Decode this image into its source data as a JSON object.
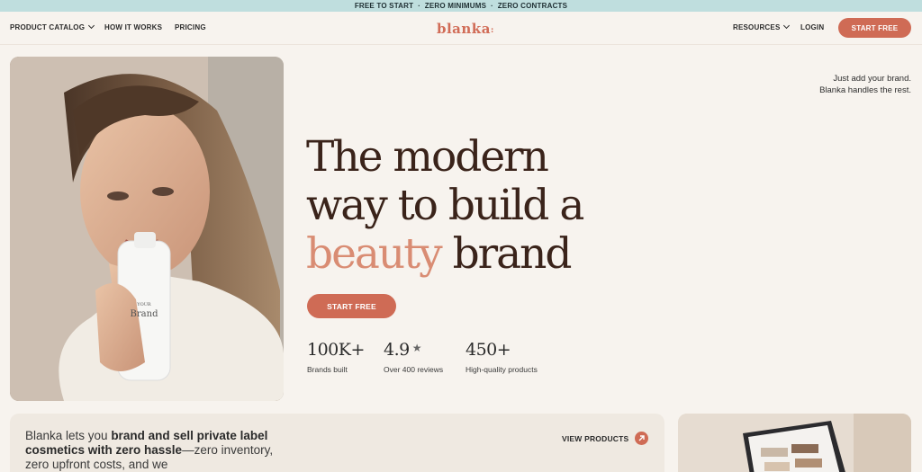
{
  "promo_bar": {
    "text": "FREE TO START  ·  ZERO MINIMUMS  ·  ZERO CONTRACTS"
  },
  "nav": {
    "product_catalog": "PRODUCT CATALOG",
    "how_it_works": "HOW IT WORKS",
    "pricing": "PRICING",
    "logo": "blanka",
    "resources": "RESOURCES",
    "login": "LOGIN",
    "start_free": "START FREE"
  },
  "tagline": {
    "line1": "Just add your brand.",
    "line2": "Blanka handles the rest."
  },
  "hero": {
    "line1": "The modern",
    "line2": "way to build a",
    "accent": "beauty",
    "line3_rest": " brand",
    "cta": "START FREE",
    "product_label_small": "YOUR",
    "product_label_big": "Brand"
  },
  "stats": [
    {
      "value": "100K+",
      "label": "Brands built"
    },
    {
      "value": "4.9",
      "label": "Over 400 reviews"
    },
    {
      "value": "450+",
      "label": "High-quality products"
    }
  ],
  "card": {
    "intro": "Blanka lets you ",
    "bold": "brand and sell private label cosmetics with zero hassle",
    "rest": "—zero inventory, zero upfront costs, and we",
    "view_products": "VIEW PRODUCTS"
  },
  "colors": {
    "accent": "#cf6b55",
    "accent_light": "#d98c73",
    "promo_bg": "#bfdede",
    "page_bg": "#f7f3ee",
    "heading": "#3a231a"
  }
}
